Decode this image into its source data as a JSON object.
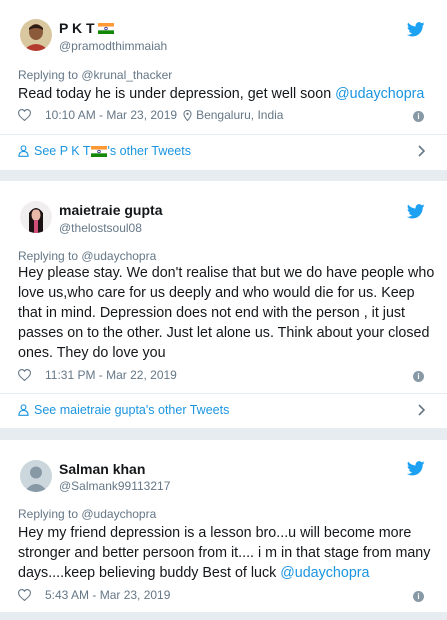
{
  "tweets": [
    {
      "name": "P K T",
      "handle": "@pramodthimmaiah",
      "replying": "Replying to @krunal_thacker",
      "body_parts": [
        "Read today he is under depression, get well soon ",
        "@udaychopra"
      ],
      "time": "10:10 AM - Mar 23, 2019",
      "location": "Bengaluru, India",
      "see_prefix": "See P K T ",
      "see_suffix": "'s other Tweets"
    },
    {
      "name": "maietraie gupta",
      "handle": "@thelostsoul08",
      "replying": "Replying to @udaychopra",
      "body": "Hey please stay. We don't realise that but we do have people who love us,who care for us deeply and who would die for us. Keep that in mind. Depression does not end with the person , it just passes on to the other. Just let alone us. Think about your closed ones. They do love you",
      "time": "11:31 PM - Mar 22, 2019",
      "see": "See maietraie gupta's other Tweets"
    },
    {
      "name": "Salman khan",
      "handle": "@Salmank99113217",
      "replying": "Replying to @udaychopra",
      "body_parts": [
        "Hey my friend depression is a lesson bro...u will become more stronger and better persoon from it.... i m in that stage from many days....keep believing buddy Best of luck ",
        "@udaychopra"
      ],
      "time": "5:43 AM - Mar 23, 2019"
    }
  ],
  "colors": {
    "link": "#1b95e0",
    "muted": "#657786",
    "background": "#e6ecf0"
  },
  "icons": [
    "twitter-bird-icon",
    "heart-icon",
    "location-pin-icon",
    "info-icon",
    "person-icon",
    "chevron-right-icon",
    "india-flag-icon"
  ]
}
